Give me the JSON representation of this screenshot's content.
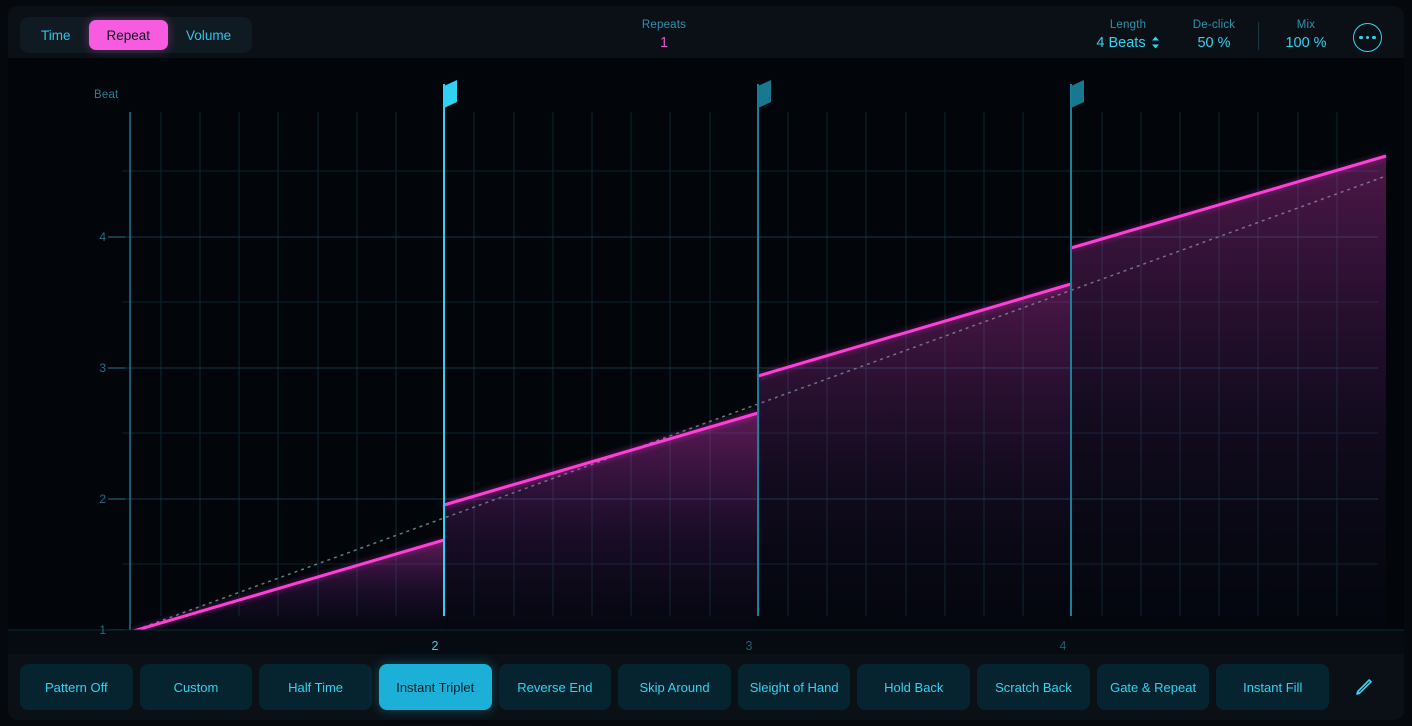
{
  "toolbar": {
    "segments": [
      {
        "label": "Time",
        "active": false
      },
      {
        "label": "Repeat",
        "active": true
      },
      {
        "label": "Volume",
        "active": false
      }
    ],
    "repeats": {
      "label": "Repeats",
      "value": "1"
    },
    "length": {
      "label": "Length",
      "value": "4 Beats",
      "stepper": "⌃⌄"
    },
    "declick": {
      "label": "De-click",
      "value": "50 %"
    },
    "mix": {
      "label": "Mix",
      "value": "100 %"
    },
    "more_icon": "more-options-icon"
  },
  "graph": {
    "y_axis_title": "Beat",
    "y_ticks": [
      "4",
      "3",
      "2",
      "1"
    ],
    "x_ticks": [
      {
        "label": "2",
        "highlighted": true
      },
      {
        "label": "3",
        "highlighted": false
      },
      {
        "label": "4",
        "highlighted": false
      }
    ],
    "markers": [
      {
        "name": "marker-2",
        "highlighted": true
      },
      {
        "name": "marker-3",
        "highlighted": false
      },
      {
        "name": "marker-4",
        "highlighted": false
      }
    ]
  },
  "chart_data": {
    "type": "line",
    "title": "",
    "xlabel": "",
    "ylabel": "Beat",
    "grid": true,
    "xlim": [
      1,
      5
    ],
    "ylim": [
      1,
      5
    ],
    "x_tick_values": [
      2,
      3,
      4
    ],
    "y_tick_values": [
      1,
      2,
      3,
      4
    ],
    "series": [
      {
        "name": "Reference (dotted)",
        "style": "dotted",
        "color": "#4a6a66",
        "x": [
          1,
          5
        ],
        "y": [
          1,
          5
        ]
      },
      {
        "name": "Instant Triplet curve",
        "style": "solid",
        "color": "#ff3fd8",
        "stepped": true,
        "segments": [
          {
            "x": [
              1.0,
              2.0
            ],
            "y": [
              1.0,
              1.707
            ]
          },
          {
            "x": [
              2.0,
              3.0
            ],
            "y": [
              1.975,
              2.683
            ]
          },
          {
            "x": [
              3.0,
              4.0
            ],
            "y": [
              2.951,
              3.659
            ]
          },
          {
            "x": [
              4.0,
              5.0
            ],
            "y": [
              3.927,
              4.634
            ]
          }
        ],
        "jumps": [
          {
            "x": 2.0,
            "from": 1.707,
            "to": 1.975
          },
          {
            "x": 3.0,
            "from": 2.683,
            "to": 2.951
          },
          {
            "x": 4.0,
            "from": 3.659,
            "to": 3.927
          }
        ]
      }
    ]
  },
  "presets": [
    {
      "label": "Pattern Off",
      "active": false
    },
    {
      "label": "Custom",
      "active": false
    },
    {
      "label": "Half Time",
      "active": false
    },
    {
      "label": "Instant Triplet",
      "active": true
    },
    {
      "label": "Reverse End",
      "active": false
    },
    {
      "label": "Skip Around",
      "active": false
    },
    {
      "label": "Sleight of Hand",
      "active": false
    },
    {
      "label": "Hold Back",
      "active": false
    },
    {
      "label": "Scratch Back",
      "active": false
    },
    {
      "label": "Gate & Repeat",
      "active": false
    },
    {
      "label": "Instant Fill",
      "active": false
    }
  ],
  "edit_icon": "pencil-icon"
}
